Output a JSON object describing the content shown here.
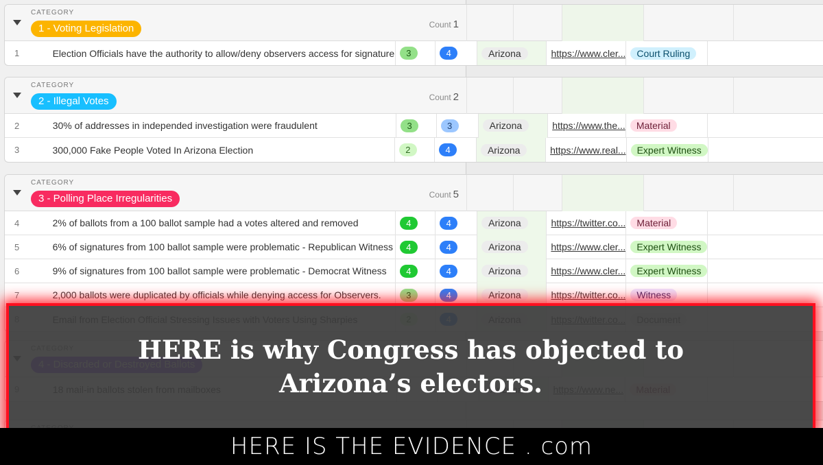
{
  "category_label": "CATEGORY",
  "count_label": "Count",
  "groups": [
    {
      "name": "1 - Voting Legislation",
      "color": "#fcb400",
      "count": "1",
      "rows": [
        {
          "num": "1",
          "title": "Election Officials have the authority to allow/deny observers access for signature verification",
          "score1": "3",
          "score2": "4",
          "state": "Arizona",
          "link": "https://www.cler...",
          "tag": "Court Ruling",
          "tag_bg": "#d0f0fd",
          "tag_fg": "#0b4f6c",
          "s1_bg": "#93e088",
          "s1_fg": "#1e5c17",
          "s2_bg": "#2d7ff9",
          "s2_fg": "#ffffff"
        }
      ]
    },
    {
      "name": "2 - Illegal Votes",
      "color": "#18bfff",
      "count": "2",
      "rows": [
        {
          "num": "2",
          "title": "30% of addresses in independed investigation were fraudulent",
          "score1": "3",
          "score2": "3",
          "state": "Arizona",
          "link": "https://www.the...",
          "tag": "Material",
          "tag_bg": "#ffdce5",
          "tag_fg": "#6e2038",
          "s1_bg": "#93e088",
          "s1_fg": "#1e5c17",
          "s2_bg": "#9cc7ff",
          "s2_fg": "#1d3f73"
        },
        {
          "num": "3",
          "title": "300,000 Fake People Voted In Arizona Election",
          "score1": "2",
          "score2": "4",
          "state": "Arizona",
          "link": "https://www.real...",
          "tag": "Expert Witness",
          "tag_bg": "#d1f7c4",
          "tag_fg": "#1e4f12",
          "s1_bg": "#d1f7c4",
          "s1_fg": "#2f6b22",
          "s2_bg": "#2d7ff9",
          "s2_fg": "#ffffff"
        }
      ]
    },
    {
      "name": "3 - Polling Place Irregularities",
      "color": "#f82b60",
      "count": "5",
      "rows": [
        {
          "num": "4",
          "title": "2% of ballots from a 100 ballot sample had a votes altered and removed",
          "score1": "4",
          "score2": "4",
          "state": "Arizona",
          "link": "https://twitter.co...",
          "tag": "Material",
          "tag_bg": "#ffdce5",
          "tag_fg": "#6e2038",
          "s1_bg": "#20c933",
          "s1_fg": "#ffffff",
          "s2_bg": "#2d7ff9",
          "s2_fg": "#ffffff"
        },
        {
          "num": "5",
          "title": "6% of signatures from 100 ballot sample were problematic - Republican Witness",
          "score1": "4",
          "score2": "4",
          "state": "Arizona",
          "link": "https://www.cler...",
          "tag": "Expert Witness",
          "tag_bg": "#d1f7c4",
          "tag_fg": "#1e4f12",
          "s1_bg": "#20c933",
          "s1_fg": "#ffffff",
          "s2_bg": "#2d7ff9",
          "s2_fg": "#ffffff"
        },
        {
          "num": "6",
          "title": "9% of signatures from 100 ballot sample were problematic - Democrat Witness",
          "score1": "4",
          "score2": "4",
          "state": "Arizona",
          "link": "https://www.cler...",
          "tag": "Expert Witness",
          "tag_bg": "#d1f7c4",
          "tag_fg": "#1e4f12",
          "s1_bg": "#20c933",
          "s1_fg": "#ffffff",
          "s2_bg": "#2d7ff9",
          "s2_fg": "#ffffff"
        },
        {
          "num": "7",
          "title": "2,000 ballots were duplicated by officials while denying access for Observers.",
          "score1": "3",
          "score2": "4",
          "state": "Arizona",
          "link": "https://twitter.co...",
          "tag": "Witness",
          "tag_bg": "#ede2fe",
          "tag_fg": "#3d2a6b",
          "s1_bg": "#93e088",
          "s1_fg": "#1e5c17",
          "s2_bg": "#2d7ff9",
          "s2_fg": "#ffffff"
        },
        {
          "num": "8",
          "title": "Email from Election Official Stressing Issues with Voters Using Sharpies",
          "score1": "2",
          "score2": "4",
          "state": "Arizona",
          "link": "https://twitter.co...",
          "tag": "Document",
          "tag_bg": "#eeeeee",
          "tag_fg": "#444444",
          "s1_bg": "#d1f7c4",
          "s1_fg": "#2f6b22",
          "s2_bg": "#2d7ff9",
          "s2_fg": "#ffffff"
        }
      ]
    },
    {
      "name": "4 - Discarded or Destroyed Ballots",
      "color": "#8b46ff",
      "count": "",
      "rows": [
        {
          "num": "9",
          "title": "18 mail-in ballots stolen from mailboxes",
          "score1": "",
          "score2": "",
          "state": "Arizona",
          "link": "https://www.ne...",
          "tag": "Material",
          "tag_bg": "#ffdce5",
          "tag_fg": "#6e2038",
          "s1_bg": "",
          "s1_fg": "",
          "s2_bg": "",
          "s2_fg": ""
        }
      ]
    },
    {
      "name": "",
      "color": "#cccccc",
      "count": "",
      "rows": []
    }
  ],
  "overlay": {
    "line1": "HERE is why Congress has objected to",
    "line2": "Arizona’s electors."
  },
  "footer": {
    "text": "HERE IS THE EVIDENCE . com"
  }
}
